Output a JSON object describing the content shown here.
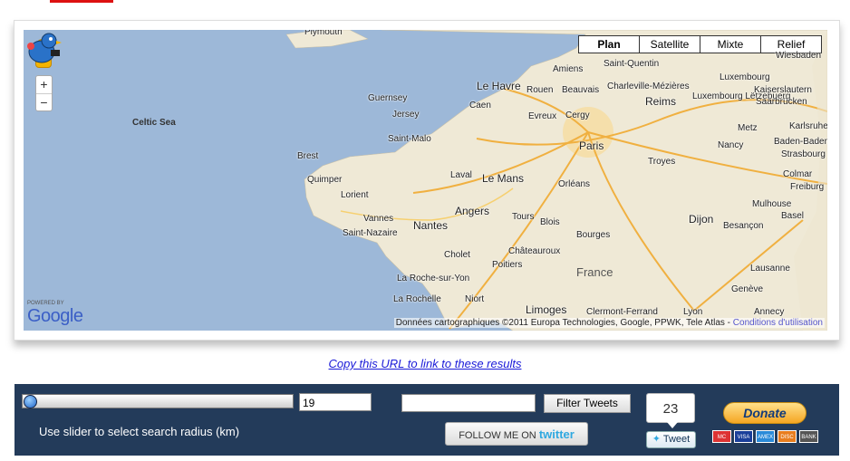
{
  "map": {
    "map_types": [
      "Plan",
      "Satellite",
      "Mixte",
      "Relief"
    ],
    "seas": [
      "Celtic Sea"
    ],
    "country_label": "France",
    "cities": [
      "Plymouth",
      "Guernsey",
      "Jersey",
      "Saint-Malo",
      "Brest",
      "Quimper",
      "Lorient",
      "Vannes",
      "Saint-Nazaire",
      "Nantes",
      "Laval",
      "Le Mans",
      "Angers",
      "Tours",
      "Blois",
      "Orléans",
      "Paris",
      "Rouen",
      "Le Havre",
      "Caen",
      "Evreux",
      "Cergy",
      "Beauvais",
      "Amiens",
      "Saint-Quentin",
      "Charleville-Mézières",
      "Reims",
      "Troyes",
      "Luxembourg",
      "Luxembourg Lëtzebuerg",
      "Metz",
      "Nancy",
      "Kaiserslautern",
      "Saarbrücken",
      "Karlsruhe",
      "Baden-Baden",
      "Strasbourg",
      "Colmar",
      "Freiburg",
      "Mulhouse",
      "Basel",
      "Dijon",
      "Besançon",
      "Bourges",
      "Châteauroux",
      "Cholet",
      "La Roche-sur-Yon",
      "Poitiers",
      "La Rochelle",
      "Niort",
      "Limoges",
      "Clermont-Ferrand",
      "Lyon",
      "Annecy",
      "Genève",
      "Lausanne",
      "Wiesbaden"
    ],
    "attribution_text": "Données cartographiques ©2011 Europa Technologies, Google, PPWK, Tele Atlas -",
    "attribution_link": "Conditions d'utilisation",
    "powered_by": "POWERED BY",
    "google_logo": "Google"
  },
  "url_link": "Copy this URL to link to these results",
  "controls": {
    "slider_value": 19,
    "radius_input": "19",
    "slider_label": "Use slider to select search radius (km)",
    "filter_placeholder": "",
    "filter_button": "Filter Tweets",
    "follow_text": "FOLLOW ME ON",
    "follow_brand": "twitter",
    "tweet_count": "23",
    "tweet_button": "Tweet",
    "donate_label": "Donate",
    "cards": [
      "MC",
      "VISA",
      "AMEX",
      "DISC",
      "BANK"
    ]
  },
  "colors": {
    "panel_bg": "#233b5a",
    "sea": "#9db8d8",
    "land": "#efe9d6",
    "link": "#1a1ad8"
  }
}
